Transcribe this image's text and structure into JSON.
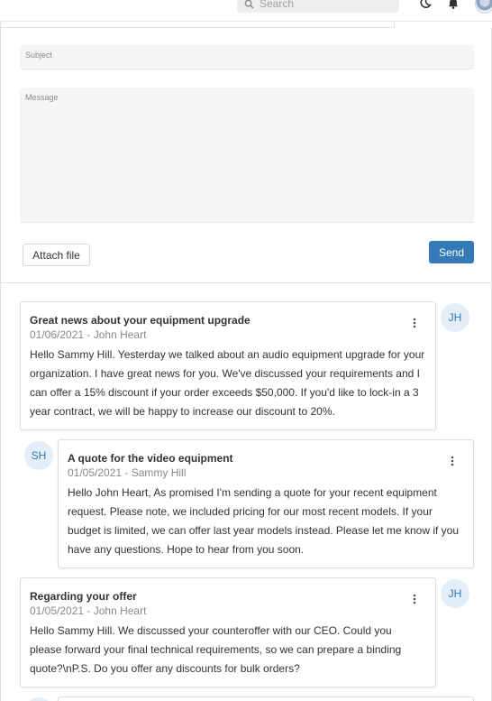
{
  "header": {
    "search_placeholder": "Search",
    "icons": [
      "search-icon",
      "moon-icon",
      "bell-icon",
      "user-avatar"
    ]
  },
  "compose": {
    "subject_label": "Subject",
    "message_label": "Message",
    "attach_label": "Attach file",
    "send_label": "Send"
  },
  "messages": [
    {
      "title": "Great news about your equipment upgrade",
      "meta": "01/06/2021 - John Heart",
      "initials": "JH",
      "body": [
        "Hello Sammy Hill. Yesterday we talked about an audio equipment upgrade for your",
        "organization. I have great news for you. We've discussed your requirements and I",
        "can offer a 15% discount if your order exceeds $50,000. If you'd like to lock-in a 3",
        "year contract, we will be happy to increase our discount to 20%."
      ]
    },
    {
      "title": "A quote for the video equipment",
      "meta": "01/05/2021 - Sammy Hill",
      "initials": "SH",
      "body": [
        "Hello John Heart, As promised I'm sending a quote for your recent equipment",
        "request. Please note, we included pricing for our most recent models. If your",
        "budget is limited, we can offer last year models instead. Please let me know if you",
        "have any questions. Hope to hear from you soon."
      ]
    },
    {
      "title": "Regarding your offer",
      "meta": "01/05/2021 - John Heart",
      "initials": "JH",
      "body": [
        "Hello Sammy Hill. We discussed your counteroffer with our CEO. Could you",
        "please forward your final technical requirements, so we can prepare a binding",
        "quote?\\nP.S. Do you offer any discounts for bulk orders?"
      ]
    }
  ],
  "colors": {
    "accent": "#337ab7",
    "avatar_bg": "#e3eef8",
    "meta_text": "#888888"
  }
}
